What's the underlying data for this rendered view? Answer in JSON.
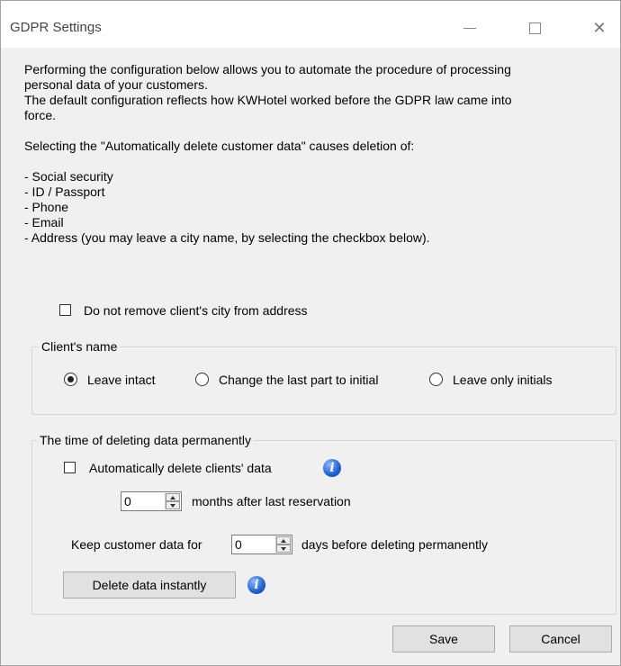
{
  "window": {
    "title": "GDPR Settings",
    "minimize_icon": "minimize-icon",
    "maximize_icon": "maximize-icon",
    "close_icon": "close-icon",
    "close_glyph": "✕"
  },
  "intro": {
    "line1": "Performing the configuration below allows you to automate the procedure of processing",
    "line2": "personal data of your customers.",
    "line3": "The default configuration reflects how KWHotel worked before the GDPR law came into",
    "line4": "force.",
    "line5": "Selecting the \"Automatically delete customer data\" causes deletion of:",
    "items": [
      "- Social security",
      "- ID / Passport",
      "- Phone",
      "- Email",
      "- Address (you may leave a city name, by selecting the checkbox below)."
    ]
  },
  "keep_city": {
    "label": "Do not remove client's city from address",
    "checked": false
  },
  "client_name": {
    "legend": "Client's name",
    "options": [
      "Leave intact",
      "Change the last part to initial",
      "Leave only initials"
    ],
    "selected": "Leave intact"
  },
  "deletion": {
    "legend": "The time of deleting data permanently",
    "auto_delete_label": "Automatically delete clients' data",
    "auto_delete_checked": false,
    "info_glyph": "i",
    "months_value": "0",
    "months_label": "months after last reservation",
    "keep_prefix": "Keep customer data for",
    "days_value": "0",
    "keep_suffix": "days before deleting permanently",
    "delete_now_label": "Delete data instantly"
  },
  "footer": {
    "save_label": "Save",
    "cancel_label": "Cancel"
  }
}
